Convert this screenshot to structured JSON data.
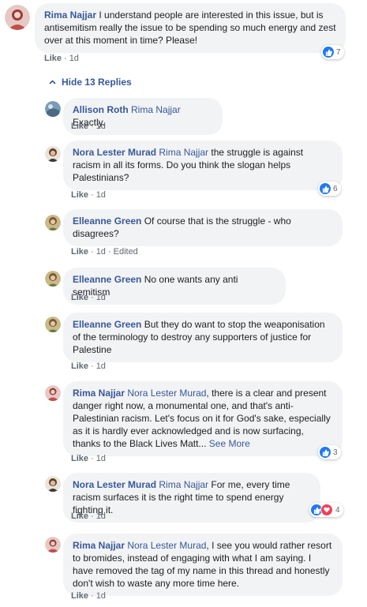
{
  "top_comment": {
    "author": "Rima Najjar",
    "text": "I understand people are interested in this issue, but is antisemitism really the issue to be spending so much energy and zest over at this moment in time? Please!",
    "like_label": "Like",
    "time": "1d",
    "reactions": "7"
  },
  "hide_replies_label": "Hide 13 Replies",
  "replies": [
    {
      "author": "Allison Roth",
      "mention": "Rima Najjar",
      "text": "Exactly.",
      "like_label": "Like",
      "time": "1d"
    },
    {
      "author": "Nora Lester Murad",
      "mention": "Rima Najjar",
      "text": "the struggle is against racism in all its forms. Do you think the slogan helps Palestinians?",
      "like_label": "Like",
      "time": "1d",
      "reactions": "6"
    },
    {
      "author": "Elleanne Green",
      "text": "Of course that is the struggle - who disagrees?",
      "like_label": "Like",
      "time": "1d",
      "edited": "Edited"
    },
    {
      "author": "Elleanne Green",
      "text": "No one wants any anti semitism",
      "like_label": "Like",
      "time": "1d"
    },
    {
      "author": "Elleanne Green",
      "text": "But they do want to stop the weaponisation of the terminology to destroy any supporters of justice for Palestine",
      "like_label": "Like",
      "time": "1d"
    },
    {
      "author": "Rima Najjar",
      "mention": "Nora Lester Murad",
      "text": ", there is a clear and present danger right now, a monumental one, and that's anti-Palestinian racism. Let's focus on it for God's sake, especially as it is hardly ever acknowledged and is now surfacing, thanks to the Black Lives Matt...",
      "see_more": "See More",
      "like_label": "Like",
      "time": "1d",
      "reactions": "3"
    },
    {
      "author": "Nora Lester Murad",
      "mention": "Rima Najjar",
      "text": "For me, every time racism surfaces it is the right time to spend energy fighting it.",
      "like_label": "Like",
      "time": "1d",
      "reactions": "4"
    },
    {
      "author": "Rima Najjar",
      "mention": "Nora Lester Murad",
      "text": ", I see you would rather resort to bromides, instead of engaging with what I am saying. I have removed the tag of my name in this thread and honestly don't wish to waste any more time here.",
      "like_label": "Like",
      "time": "1d"
    }
  ],
  "colors": {
    "link": "#385898",
    "bubble": "#f2f3f5",
    "like_reaction": "#2078f4",
    "love_reaction": "#f33e58"
  }
}
